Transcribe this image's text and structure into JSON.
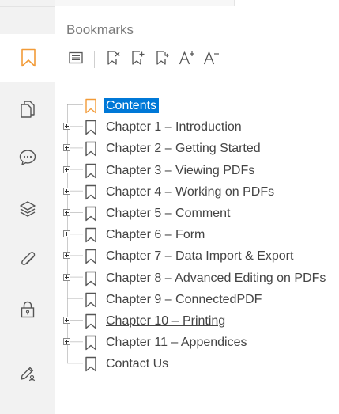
{
  "panel": {
    "title": "Bookmarks"
  },
  "rail": {
    "items": [
      {
        "icon": "bookmark-icon",
        "active": true
      },
      {
        "icon": "pages-icon"
      },
      {
        "icon": "comments-icon"
      },
      {
        "icon": "layers-icon"
      },
      {
        "icon": "attachment-icon"
      },
      {
        "icon": "security-lock-icon"
      },
      {
        "icon": "signature-pen-icon"
      }
    ]
  },
  "toolbar": {
    "buttons": [
      {
        "icon": "bookmark-options-icon"
      },
      {
        "icon": "delete-bookmark-icon"
      },
      {
        "icon": "add-bookmark-icon"
      },
      {
        "icon": "add-child-bookmark-icon"
      },
      {
        "icon": "increase-font-size-icon"
      },
      {
        "icon": "decrease-font-size-icon"
      }
    ]
  },
  "colors": {
    "accent": "#f29b38",
    "selection": "#0078d7",
    "text": "#444444"
  },
  "bookmarks": [
    {
      "label": "Contents",
      "expandable": false,
      "selected": true
    },
    {
      "label": "Chapter 1 – Introduction",
      "expandable": true
    },
    {
      "label": "Chapter 2 – Getting Started",
      "expandable": true
    },
    {
      "label": "Chapter 3 – Viewing PDFs",
      "expandable": true
    },
    {
      "label": "Chapter 4 – Working on PDFs",
      "expandable": true
    },
    {
      "label": "Chapter 5 – Comment",
      "expandable": true
    },
    {
      "label": "Chapter 6 – Form",
      "expandable": true
    },
    {
      "label": "Chapter 7 – Data Import & Export",
      "expandable": true
    },
    {
      "label": "Chapter 8 – Advanced Editing on PDFs",
      "expandable": true
    },
    {
      "label": "Chapter 9 – ConnectedPDF",
      "expandable": false
    },
    {
      "label": "Chapter 10 – Printing",
      "expandable": true,
      "hovered": true
    },
    {
      "label": "Chapter 11 – Appendices",
      "expandable": true
    },
    {
      "label": "Contact Us",
      "expandable": false
    }
  ]
}
